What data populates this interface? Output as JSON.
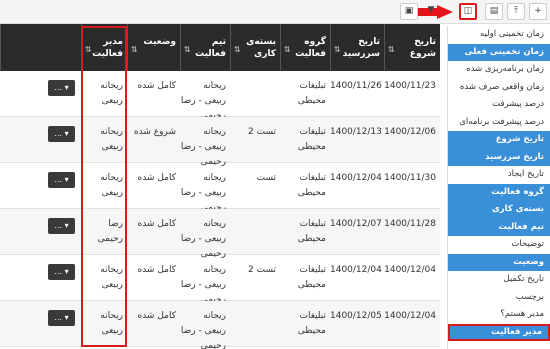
{
  "toolbar": {
    "buttons": [
      {
        "name": "add-icon",
        "glyph": "+"
      },
      {
        "name": "upload-icon",
        "glyph": "⤒"
      },
      {
        "name": "excel-icon",
        "glyph": "▤"
      },
      {
        "name": "columns-icon",
        "glyph": "◫"
      },
      {
        "name": "filter-icon",
        "glyph": "▼"
      },
      {
        "name": "save-icon",
        "glyph": "▣"
      }
    ]
  },
  "table": {
    "headers": [
      "تاریخ شروع",
      "تاریخ سررسید",
      "گروه فعالیت",
      "بسته‌ی کاری",
      "تیم فعالیت",
      "وضعیت",
      "مدیر فعالیت"
    ],
    "rows": [
      {
        "start": "1400/11/23",
        "due": "1400/11/26",
        "group": "تبلیغات محیطی",
        "package": "",
        "team": "ریحانه ربیعی - رضا رحیمی",
        "status": "کامل شده",
        "manager": "ریحانه ربیعی"
      },
      {
        "start": "1400/12/06",
        "due": "1400/12/13",
        "group": "تبلیغات محیطی",
        "package": "تست 2",
        "team": "ریحانه ربیعی - رضا رحیمی",
        "status": "شروع شده",
        "manager": "ریحانه ربیعی"
      },
      {
        "start": "1400/11/30",
        "due": "1400/12/04",
        "group": "تبلیغات محیطی",
        "package": "تست",
        "team": "ریحانه ربیعی - رضا رحیمی",
        "status": "کامل شده",
        "manager": "ریحانه ربیعی"
      },
      {
        "start": "1400/11/28",
        "due": "1400/12/07",
        "group": "تبلیغات محیطی",
        "package": "",
        "team": "ریحانه ربیعی - رضا رحیمی",
        "status": "کامل شده",
        "manager": "رضا رحیمی"
      },
      {
        "start": "1400/12/04",
        "due": "1400/12/04",
        "group": "تبلیغات محیطی",
        "package": "تست 2",
        "team": "ریحانه ربیعی - رضا رحیمی",
        "status": "کامل شده",
        "manager": "ریحانه ربیعی"
      },
      {
        "start": "1400/12/04",
        "due": "1400/12/05",
        "group": "تبلیغات محیطی",
        "package": "",
        "team": "ریحانه ربیعی - رضا رحیمی",
        "status": "کامل شده",
        "manager": "ریحانه ربیعی"
      }
    ],
    "row_menu_label": "... ▾"
  },
  "column_menu": {
    "items": [
      {
        "label": "زمان تخمینی اولیه",
        "selected": false
      },
      {
        "label": "زمان تخمینی فعلی",
        "selected": true
      },
      {
        "label": "زمان برنامه‌ریزی شده",
        "selected": false
      },
      {
        "label": "زمان واقعی صرف شده",
        "selected": false
      },
      {
        "label": "درصد پیشرفت",
        "selected": false
      },
      {
        "label": "درصد پیشرفت برنامه‌ای",
        "selected": false
      },
      {
        "label": "تاریخ شروع",
        "selected": true
      },
      {
        "label": "تاریخ سررسید",
        "selected": true
      },
      {
        "label": "تاریخ ایجاد",
        "selected": false
      },
      {
        "label": "گروه فعالیت",
        "selected": true
      },
      {
        "label": "بسته‌ی کاری",
        "selected": true
      },
      {
        "label": "تیم فعالیت",
        "selected": true
      },
      {
        "label": "توضیحات",
        "selected": false
      },
      {
        "label": "وضعیت",
        "selected": true
      },
      {
        "label": "تاریخ تکمیل",
        "selected": false
      },
      {
        "label": "برچسب",
        "selected": false
      },
      {
        "label": "مدیر هستم؟",
        "selected": false
      },
      {
        "label": "مدیر فعالیت",
        "selected": true
      }
    ]
  },
  "colors": {
    "accent": "#3a8fd9",
    "header": "#2b2b2b",
    "highlight": "#d71920"
  }
}
